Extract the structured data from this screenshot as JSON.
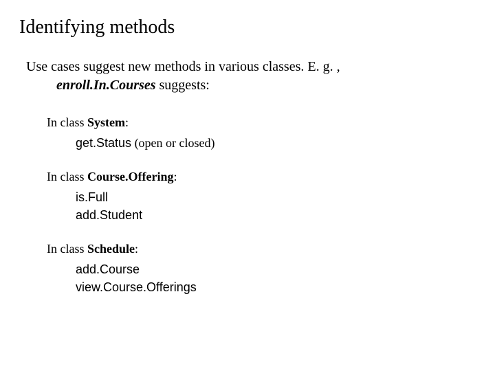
{
  "title": "Identifying methods",
  "intro": {
    "line1_pre": "Use cases suggest new methods in various classes.  E. g. ,",
    "line2_emph": "enroll.In.Courses",
    "line2_post": " suggests:"
  },
  "sections": [
    {
      "label_pre": "In class ",
      "classname": "System",
      "label_post": ":",
      "methods": [
        {
          "name": "get.Status",
          "note": " (open or closed)"
        }
      ]
    },
    {
      "label_pre": "In class ",
      "classname": "Course.Offering",
      "label_post": ":",
      "methods": [
        {
          "name": "is.Full",
          "note": ""
        },
        {
          "name": "add.Student",
          "note": ""
        }
      ]
    },
    {
      "label_pre": "In class ",
      "classname": "Schedule",
      "label_post": ":",
      "methods": [
        {
          "name": "add.Course",
          "note": ""
        },
        {
          "name": "view.Course.Offerings",
          "note": ""
        }
      ]
    }
  ]
}
